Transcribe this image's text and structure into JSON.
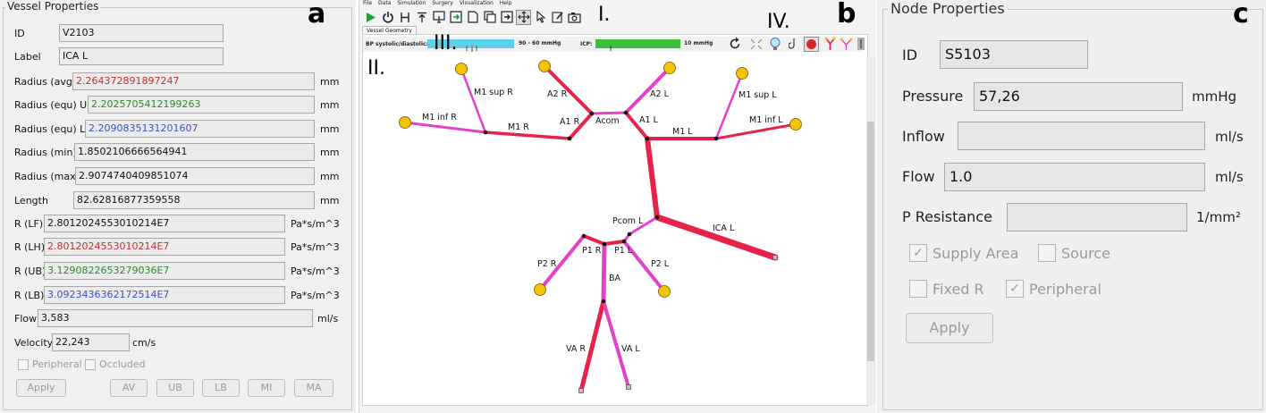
{
  "panel_a": {
    "letter": "a",
    "title": "Vessel Properties",
    "fields": [
      {
        "label": "ID",
        "value": "V2103",
        "unit": "",
        "color": "default"
      },
      {
        "label": "Label",
        "value": "ICA L",
        "unit": "",
        "color": "default"
      },
      {
        "label": "Radius (avg)",
        "value": "2.264372891897247",
        "unit": "mm",
        "color": "red"
      },
      {
        "label": "Radius (equ) UB",
        "value": "2.2025705412199263",
        "unit": "mm",
        "color": "green"
      },
      {
        "label": "Radius (equ) LB",
        "value": "2.2090835131201607",
        "unit": "mm",
        "color": "blue"
      },
      {
        "label": "Radius (min)",
        "value": "1.8502106666564941",
        "unit": "mm",
        "color": "default"
      },
      {
        "label": "Radius (max)",
        "value": "2.9074740409851074",
        "unit": "mm",
        "color": "default"
      },
      {
        "label": "Length",
        "value": "82.62816877359558",
        "unit": "mm",
        "color": "default"
      },
      {
        "label": "R (LF)",
        "value": "2.8012024553010214E7",
        "unit": "Pa*s/m^3",
        "color": "default"
      },
      {
        "label": "R (LH)",
        "value": "2.8012024553010214E7",
        "unit": "Pa*s/m^3",
        "color": "red"
      },
      {
        "label": "R (UB)",
        "value": "3.1290822653279036E7",
        "unit": "Pa*s/m^3",
        "color": "green"
      },
      {
        "label": "R (LB)",
        "value": "3.0923436362172514E7",
        "unit": "Pa*s/m^3",
        "color": "blue"
      },
      {
        "label": "Flow",
        "value": "3,583",
        "unit": "ml/s",
        "color": "default"
      },
      {
        "label": "Velocity",
        "value": "22,243",
        "unit": "cm/s",
        "color": "default"
      }
    ],
    "checkboxes": [
      {
        "label": "Peripheral",
        "checked": false
      },
      {
        "label": "Occluded",
        "checked": false
      }
    ],
    "buttons": [
      "Apply",
      "AV",
      "UB",
      "LB",
      "MI",
      "MA"
    ]
  },
  "panel_b": {
    "letter": "b",
    "menu": [
      "File",
      "Data",
      "Simulation",
      "Surgery",
      "Visualization",
      "Help"
    ],
    "toolbar_icons": [
      "play-icon",
      "power-icon",
      "h-icon",
      "upload-icon",
      "window-in-icon",
      "export-green-icon",
      "page-icon",
      "copy-icon",
      "forward-icon",
      "move-icon",
      "select-icon",
      "edit-icon",
      "camera-icon"
    ],
    "tab": "Vessel Geometry",
    "bp_label": "BP systolic/diastolic:",
    "bp_value": "90 - 60 mmHg",
    "icp_label": "ICP:",
    "icp_value": "10 mmHg",
    "roman": {
      "i": "I.",
      "ii": "II.",
      "iii": "III.",
      "iv": "IV."
    },
    "vessel_labels": [
      "M1 sup R",
      "A2 R",
      "A2 L",
      "M1 sup L",
      "M1 inf R",
      "M1 R",
      "A1 R",
      "Acom",
      "A1 L",
      "M1 L",
      "M1 inf L",
      "Pcom L",
      "ICA L",
      "P1 R",
      "P1 L",
      "P2 R",
      "P2 L",
      "BA",
      "VA R",
      "VA L"
    ],
    "colors": {
      "vessel_red": "#e8234a",
      "vessel_pink": "#e640c8",
      "node_yellow": "#f5c400",
      "bp_slider": "#5fd0ea",
      "icp_slider": "#3fbf3f"
    }
  },
  "panel_c": {
    "letter": "c",
    "title": "Node Properties",
    "fields": [
      {
        "label": "ID",
        "value": "S5103",
        "unit": ""
      },
      {
        "label": "Pressure",
        "value": "57,26",
        "unit": "mmHg"
      },
      {
        "label": "Inflow",
        "value": "",
        "unit": "ml/s"
      },
      {
        "label": "Flow",
        "value": "1.0",
        "unit": "ml/s"
      },
      {
        "label": "P Resistance",
        "value": "",
        "unit": "1/mm²"
      }
    ],
    "checkboxes": [
      {
        "label": "Supply Area",
        "checked": true
      },
      {
        "label": "Source",
        "checked": false
      },
      {
        "label": "Fixed R",
        "checked": false
      },
      {
        "label": "Peripheral",
        "checked": true
      }
    ],
    "apply_label": "Apply"
  }
}
